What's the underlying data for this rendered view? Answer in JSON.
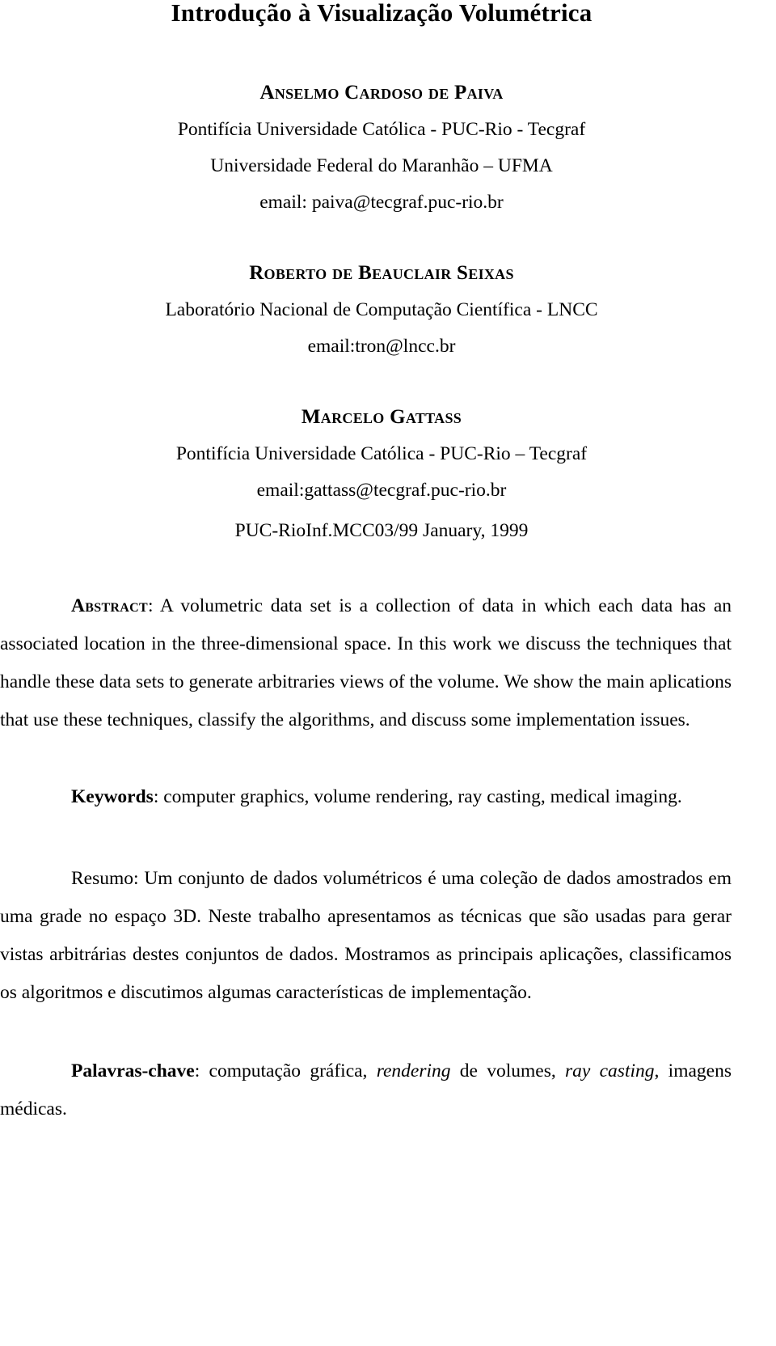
{
  "document": {
    "title": "Introdução à Visualização Volumétrica",
    "report_line": "PUC-RioInf.MCC03/99 January, 1999"
  },
  "authors": [
    {
      "name": "Anselmo Cardoso de Paiva",
      "affiliations": [
        "Pontifícia Universidade Católica - PUC-Rio - Tecgraf",
        "Universidade Federal do Maranhão – UFMA"
      ],
      "email": "email: paiva@tecgraf.puc-rio.br"
    },
    {
      "name": "Roberto de Beauclair Seixas",
      "affiliations": [
        "Laboratório Nacional de Computação Científica - LNCC"
      ],
      "email": "email:tron@lncc.br"
    },
    {
      "name": "Marcelo Gattass",
      "affiliations": [
        "Pontifícia Universidade Católica - PUC-Rio – Tecgraf"
      ],
      "email": "email:gattass@tecgraf.puc-rio.br"
    }
  ],
  "abstract": {
    "label": "Abstract",
    "separator": ": ",
    "text": "A volumetric data set is a collection of data in which each data has an associated location in the three-dimensional space. In this work we discuss the techniques that handle these data sets to generate arbitraries views of the volume. We show the main aplications that use these techniques,  classify the algorithms, and discuss some implementation issues."
  },
  "keywords": {
    "label": "Keywords",
    "separator": ": ",
    "text": "computer graphics, volume rendering, ray casting, medical imaging."
  },
  "resumo": {
    "label": "Resumo",
    "separator": ": ",
    "text": "Um conjunto de dados volumétricos é uma coleção de dados amostrados em uma grade no espaço 3D. Neste trabalho apresentamos as técnicas que  são usadas para gerar vistas arbitrárias destes conjuntos de dados. Mostramos as principais aplicações, classificamos os algoritmos e discutimos algumas características de implementação."
  },
  "palavras_chave": {
    "label": "Palavras-chave",
    "separator": ": ",
    "part1": "computação gráfica, ",
    "italic1": "rendering",
    "part2": " de volumes, ",
    "italic2": "ray casting",
    "part3": ", imagens médicas."
  }
}
